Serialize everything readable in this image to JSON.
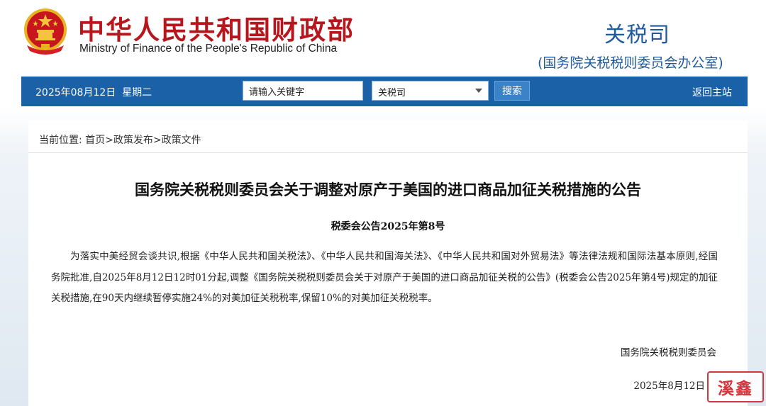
{
  "header": {
    "cn_title": "中华人民共和国财政部",
    "en_title": "Ministry of Finance of the People's Republic of China",
    "dept_name": "关税司",
    "dept_sub": "(国务院关税税则委员会办公室)"
  },
  "nav": {
    "date": "2025年08月12日  星期二",
    "search_value": "请输入关键字",
    "select_value": "关税司",
    "search_button": "搜索",
    "home_link": "返回主站"
  },
  "breadcrumb": {
    "prefix": "当前位置:",
    "items": [
      "首页",
      "政策发布",
      "政策文件"
    ],
    "separator": ">"
  },
  "doc": {
    "title": "国务院关税税则委员会关于调整对原产于美国的进口商品加征关税措施的公告",
    "number": "税委会公告2025年第8号",
    "body": "为落实中美经贸会谈共识,根据《中华人民共和国关税法》、《中华人民共和国海关法》、《中华人民共和国对外贸易法》等法律法规和国际法基本原则,经国务院批准,自2025年8月12日12时01分起,调整《国务院关税税则委员会关于对原产于美国的进口商品加征关税的公告》(税委会公告2025年第4号)规定的加征关税措施,在90天内继续暂停实施24%的对美加征关税税率,保留10%的对美加征关税税率。",
    "signer": "国务院关税税则委员会",
    "date": "2025年8月12日"
  },
  "watermark": {
    "text": "溪鑫"
  },
  "colors": {
    "brand_red": "#b8161d",
    "nav_blue": "#1b61a8",
    "dept_blue": "#1f5a9c",
    "button_blue": "#3a83c9",
    "seal_red": "#d7353c"
  }
}
